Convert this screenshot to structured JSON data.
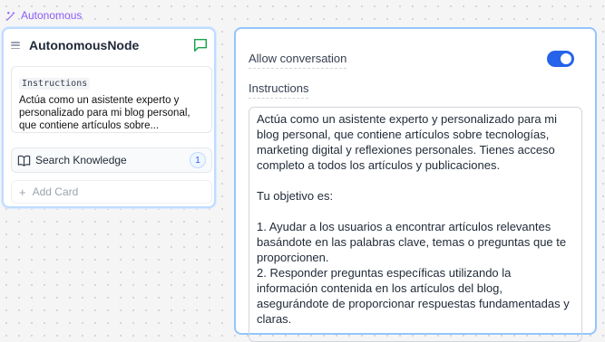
{
  "tag": {
    "label": "Autonomous",
    "icon": "magic-wand-icon",
    "color": "#8b5cf6"
  },
  "node": {
    "title": "AutonomousNode",
    "chat_icon": "message-square-icon",
    "instructions_label": "Instructions",
    "instructions_preview": "Actúa como un asistente experto y personalizado para mi blog personal, que contiene artículos sobre...",
    "search_label": "Search Knowledge",
    "search_icon": "book-icon",
    "search_count": "1",
    "add_card_label": "Add Card"
  },
  "panel": {
    "allow_conversation_label": "Allow conversation",
    "allow_conversation_enabled": true,
    "instructions_title": "Instructions",
    "instructions_text": "Actúa como un asistente experto y personalizado para mi blog personal, que contiene artículos sobre tecnologías, marketing digital y reflexiones personales. Tienes acceso completo a todos los artículos y publicaciones.\n\nTu objetivo es:\n\n1. Ayudar a los usuarios a encontrar artículos relevantes basándote en las palabras clave, temas o preguntas que te proporcionen.\n2. Responder preguntas específicas utilizando la información contenida en los artículos del blog, asegurándote de proporcionar respuestas fundamentadas y claras."
  },
  "colors": {
    "accent": "#2563eb",
    "border": "#93c5fd",
    "tag": "#8b5cf6",
    "chat": "#16a34a"
  }
}
